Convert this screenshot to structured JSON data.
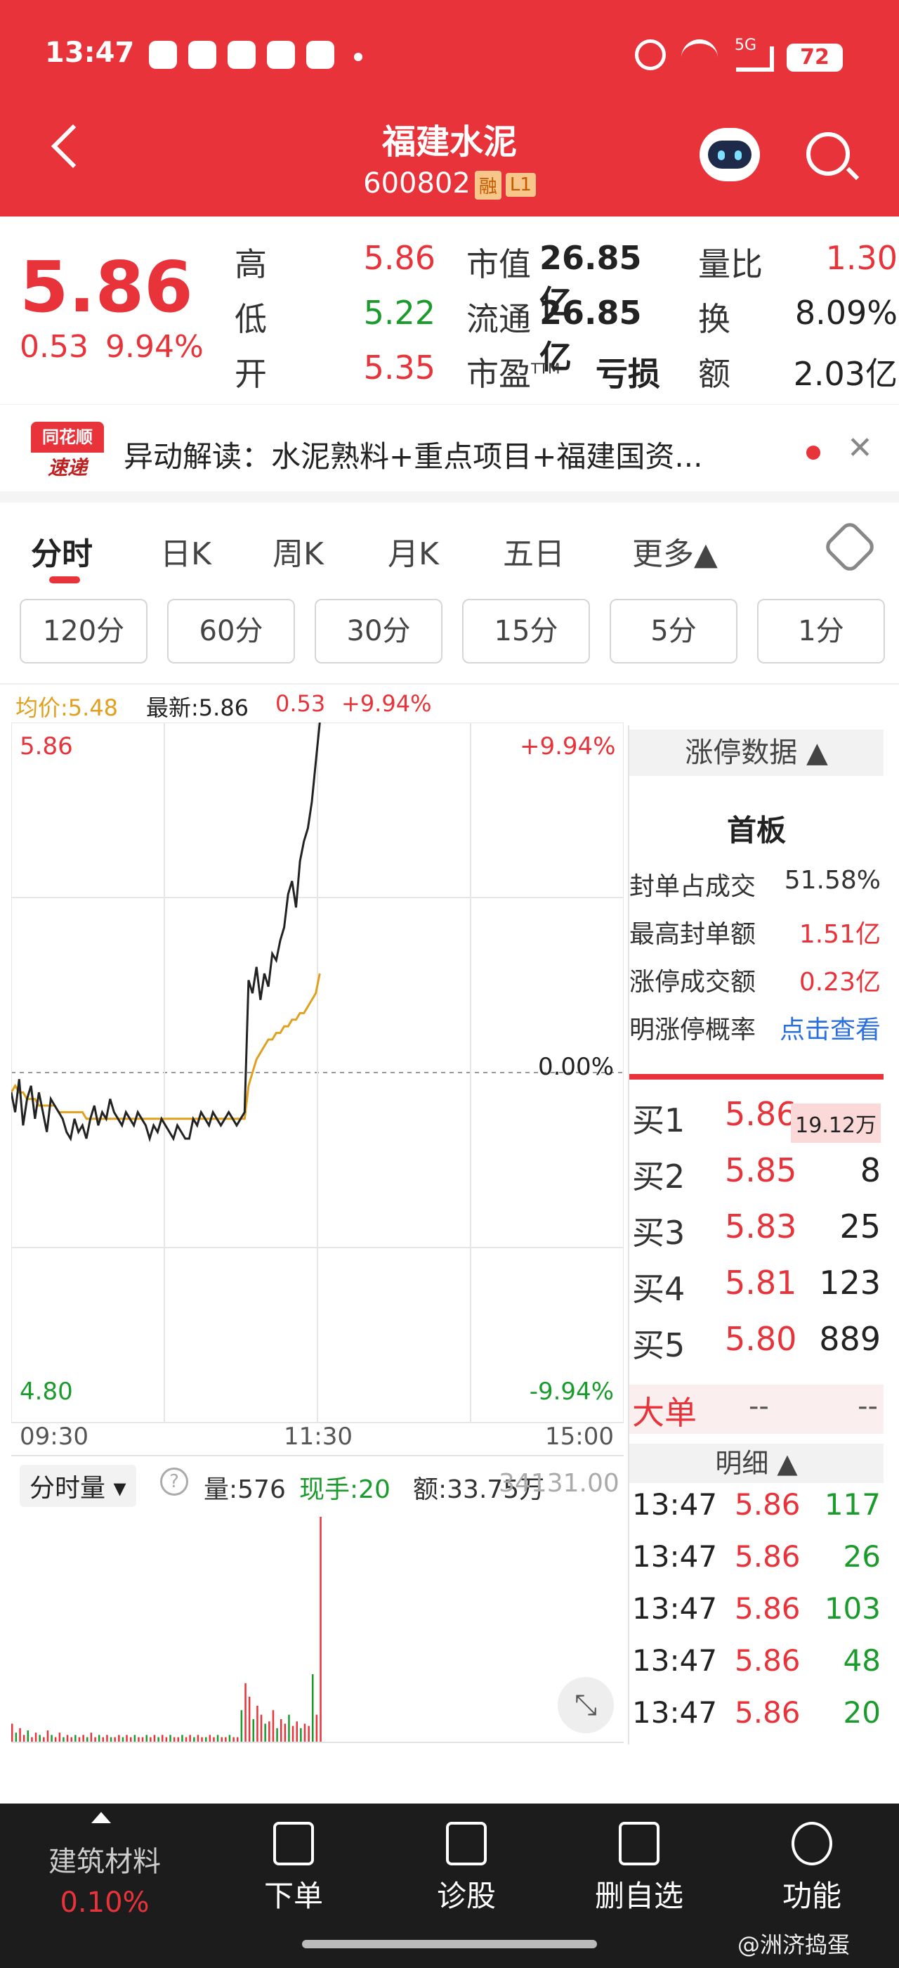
{
  "status_bar": {
    "time": "13:47",
    "network": "5G",
    "battery": "72"
  },
  "header": {
    "title": "福建水泥",
    "code": "600802",
    "tag_margin": "融",
    "tag_level": "L1"
  },
  "quote": {
    "price": "5.86",
    "change": "0.53",
    "change_pct": "9.94%",
    "high_label": "高",
    "high": "5.86",
    "low_label": "低",
    "low": "5.22",
    "open_label": "开",
    "open": "5.35",
    "mktcap_label": "市值",
    "mktcap": "26.85亿",
    "float_label": "流通",
    "float": "26.85亿",
    "pe_label": "市盈",
    "pe_sup": "TTM",
    "pe": "亏损",
    "vol_ratio_label": "量比",
    "vol_ratio": "1.30",
    "turnover_label": "换",
    "turnover": "8.09%",
    "amount_label": "额",
    "amount": "2.03亿"
  },
  "news": {
    "badge_top": "同花顺",
    "badge_bottom": "速递",
    "text": "异动解读：水泥熟料+重点项目+福建国资..."
  },
  "tabs": [
    "分时",
    "日K",
    "周K",
    "月K",
    "五日",
    "更多▲"
  ],
  "ranges": [
    "120分",
    "60分",
    "30分",
    "15分",
    "5分",
    "1分"
  ],
  "chart_header": {
    "avg_label": "均价:5.48",
    "latest_label": "最新:5.86",
    "change": "0.53",
    "change_pct": "+9.94%"
  },
  "chart_data": {
    "type": "line",
    "y_top_label": "5.86",
    "y_bottom_label": "4.80",
    "pct_top": "+9.94%",
    "pct_mid": "0.00%",
    "pct_bottom": "-9.94%",
    "x_labels": [
      "09:30",
      "11:30",
      "15:00"
    ],
    "prev_close": 5.33,
    "ylim": [
      4.8,
      5.86
    ],
    "price": [
      5.3,
      5.27,
      5.32,
      5.25,
      5.29,
      5.31,
      5.26,
      5.3,
      5.27,
      5.24,
      5.29,
      5.28,
      5.27,
      5.26,
      5.24,
      5.23,
      5.26,
      5.24,
      5.25,
      5.23,
      5.26,
      5.28,
      5.25,
      5.27,
      5.26,
      5.29,
      5.27,
      5.26,
      5.25,
      5.27,
      5.26,
      5.25,
      5.27,
      5.26,
      5.25,
      5.23,
      5.25,
      5.24,
      5.26,
      5.25,
      5.24,
      5.23,
      5.25,
      5.24,
      5.23,
      5.23,
      5.26,
      5.25,
      5.27,
      5.26,
      5.25,
      5.27,
      5.26,
      5.25,
      5.26,
      5.27,
      5.26,
      5.25,
      5.26,
      5.27,
      5.47,
      5.45,
      5.49,
      5.44,
      5.48,
      5.46,
      5.51,
      5.5,
      5.53,
      5.55,
      5.6,
      5.62,
      5.58,
      5.65,
      5.68,
      5.7,
      5.74,
      5.8,
      5.86
    ],
    "avg": [
      5.3,
      5.31,
      5.3,
      5.3,
      5.29,
      5.29,
      5.29,
      5.28,
      5.28,
      5.28,
      5.28,
      5.28,
      5.27,
      5.27,
      5.27,
      5.27,
      5.27,
      5.27,
      5.27,
      5.26,
      5.26,
      5.26,
      5.26,
      5.26,
      5.26,
      5.26,
      5.26,
      5.26,
      5.26,
      5.26,
      5.26,
      5.26,
      5.26,
      5.26,
      5.26,
      5.26,
      5.26,
      5.26,
      5.26,
      5.26,
      5.26,
      5.26,
      5.26,
      5.26,
      5.26,
      5.26,
      5.26,
      5.26,
      5.26,
      5.26,
      5.26,
      5.26,
      5.26,
      5.26,
      5.26,
      5.26,
      5.26,
      5.26,
      5.26,
      5.26,
      5.31,
      5.33,
      5.35,
      5.36,
      5.37,
      5.38,
      5.38,
      5.39,
      5.39,
      5.4,
      5.4,
      5.41,
      5.41,
      5.42,
      5.42,
      5.43,
      5.44,
      5.45,
      5.48
    ]
  },
  "volume_header": {
    "selector": "分时量",
    "vol": "量:576",
    "hand": "现手:20",
    "amount": "额:33.75万",
    "max_label": "34131.00"
  },
  "volume": [
    8,
    4,
    6,
    3,
    5,
    2,
    4,
    3,
    2,
    5,
    3,
    2,
    4,
    2,
    3,
    2,
    3,
    2,
    3,
    2,
    4,
    2,
    3,
    2,
    3,
    2,
    2,
    3,
    2,
    3,
    2,
    3,
    2,
    2,
    3,
    2,
    3,
    2,
    3,
    2,
    3,
    2,
    2,
    3,
    2,
    3,
    2,
    3,
    2,
    2,
    3,
    2,
    3,
    2,
    2,
    3,
    2,
    2,
    14,
    26,
    20,
    10,
    16,
    12,
    8,
    9,
    14,
    6,
    10,
    8,
    12,
    7,
    9,
    6,
    8,
    7,
    30,
    12,
    100
  ],
  "limit_panel": {
    "title": "涨停数据 ▲",
    "board": "首板",
    "rows": [
      {
        "label": "封单占成交",
        "value": "51.58%"
      },
      {
        "label": "最高封单额",
        "value": "1.51亿"
      },
      {
        "label": "涨停成交额",
        "value": "0.23亿"
      },
      {
        "label": "明涨停概率",
        "value": "点击查看"
      }
    ]
  },
  "order_book": [
    {
      "label": "买1",
      "price": "5.86",
      "vol": "19.12万"
    },
    {
      "label": "买2",
      "price": "5.85",
      "vol": "8"
    },
    {
      "label": "买3",
      "price": "5.83",
      "vol": "25"
    },
    {
      "label": "买4",
      "price": "5.81",
      "vol": "123"
    },
    {
      "label": "买5",
      "price": "5.80",
      "vol": "889"
    }
  ],
  "big_order": {
    "label": "大单",
    "v1": "--",
    "v2": "--"
  },
  "ticks_header": "明细 ▲",
  "ticks": [
    {
      "t": "13:47",
      "p": "5.86",
      "v": "117"
    },
    {
      "t": "13:47",
      "p": "5.86",
      "v": "26"
    },
    {
      "t": "13:47",
      "p": "5.86",
      "v": "103"
    },
    {
      "t": "13:47",
      "p": "5.86",
      "v": "48"
    },
    {
      "t": "13:47",
      "p": "5.86",
      "v": "20"
    }
  ],
  "bottom_bar": {
    "sector": "建筑材料",
    "sector_pct": "0.10%",
    "items": [
      "下单",
      "诊股",
      "删自选",
      "功能"
    ]
  },
  "watermark": "@洲济捣蛋",
  "colors": {
    "up": "#e8333a",
    "down": "#1a9b2c",
    "avg": "#e0a020",
    "header": "#e8333a"
  }
}
